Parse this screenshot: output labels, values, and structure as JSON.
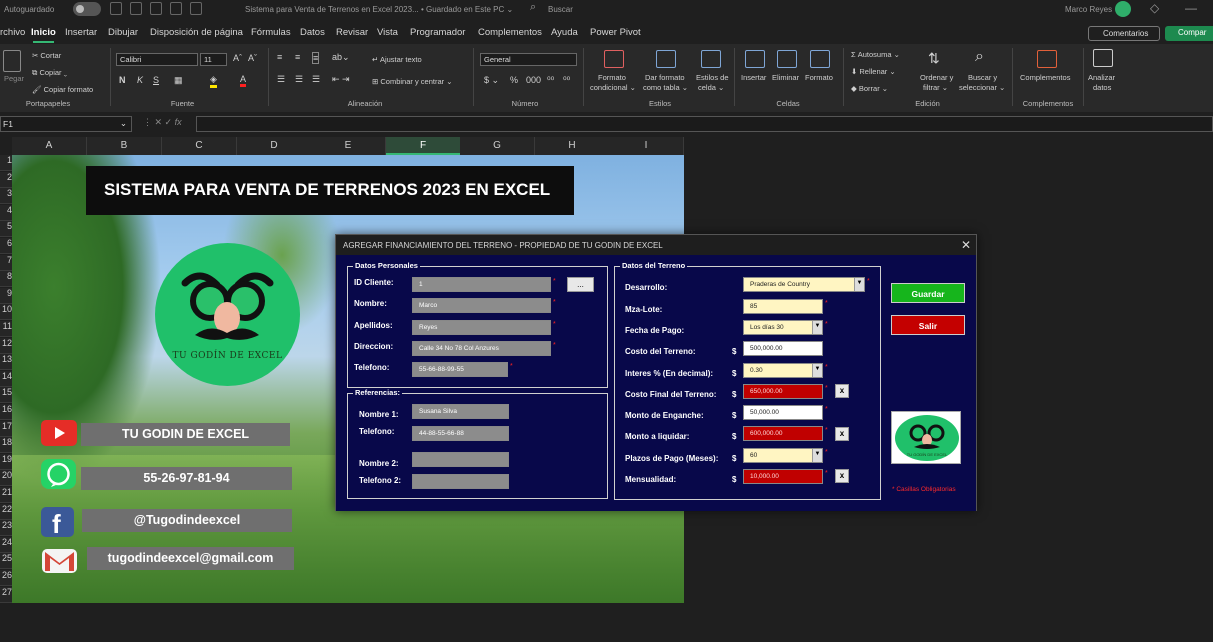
{
  "titlebar": {
    "autosave": "Autoguardado",
    "document": "Sistema para Venta de Terrenos en Excel 2023... • Guardado en Este PC ⌄",
    "search_placeholder": "Buscar",
    "user": "Marco Reyes"
  },
  "menu": {
    "tabs": [
      "rchivo",
      "Inicio",
      "Insertar",
      "Dibujar",
      "Disposición de página",
      "Fórmulas",
      "Datos",
      "Revisar",
      "Vista",
      "Programador",
      "Complementos",
      "Ayuda",
      "Power Pivot"
    ],
    "active": "Inicio",
    "comments": "Comentarios",
    "share": "Compar"
  },
  "ribbon": {
    "paste": "Pegar",
    "cut": "Cortar",
    "copy": "Copiar",
    "format_painter": "Copiar formato",
    "clipboard": "Portapapeles",
    "font_name": "Calibri",
    "font_size": "11",
    "bold": "N",
    "italic": "K",
    "underline": "S",
    "font_group": "Fuente",
    "wrap_text": "Ajustar texto",
    "merge": "Combinar y centrar",
    "align_group": "Alineación",
    "number_format": "General",
    "number_group": "Número",
    "cond_format_1": "Formato",
    "cond_format_2": "condicional ⌄",
    "as_table_1": "Dar formato",
    "as_table_2": "como tabla ⌄",
    "cell_styles_1": "Estilos de",
    "cell_styles_2": "celda ⌄",
    "styles_group": "Estilos",
    "insert": "Insertar",
    "delete": "Eliminar",
    "format": "Formato",
    "cells_group": "Celdas",
    "autosum": "Autosuma ⌄",
    "fill": "Rellenar ⌄",
    "clear": "Borrar ⌄",
    "sort_1": "Ordenar y",
    "sort_2": "filtrar ⌄",
    "find_1": "Buscar y",
    "find_2": "seleccionar ⌄",
    "editing_group": "Edición",
    "addins": "Complementos",
    "addins_group": "Complementos",
    "analyze_1": "Analizar",
    "analyze_2": "datos"
  },
  "formula_bar": {
    "name_box": "F1",
    "fx": "fx"
  },
  "columns": [
    "A",
    "B",
    "C",
    "D",
    "E",
    "F",
    "G",
    "H",
    "I"
  ],
  "selected_column": "F",
  "rows": [
    "1",
    "2",
    "3",
    "4",
    "5",
    "6",
    "7",
    "8",
    "9",
    "10",
    "11",
    "12",
    "13",
    "14",
    "15",
    "16",
    "17",
    "18",
    "19",
    "20",
    "21",
    "22",
    "23",
    "24",
    "25",
    "26",
    "27"
  ],
  "sheet": {
    "banner": "SISTEMA PARA VENTA DE TERRENOS 2023 EN EXCEL",
    "logo_text": "TU GODÍN DE EXCEL",
    "youtube": "TU GODIN DE EXCEL",
    "whatsapp": "55-26-97-81-94",
    "facebook": "@Tugodindeexcel",
    "email": "tugodindeexcel@gmail.com",
    "colors": {
      "youtube": "#e52d27",
      "whatsapp": "#25d366",
      "facebook": "#3b5998",
      "gmail": "#d44638"
    }
  },
  "dialog": {
    "title": "AGREGAR FINANCIAMIENTO DEL TERRENO - PROPIEDAD DE TU GODIN DE EXCEL",
    "personal": {
      "frame": "Datos Personales",
      "id_label": "ID Cliente:",
      "id_value": "1",
      "browse": "...",
      "name_label": "Nombre:",
      "name_value": "Marco",
      "last_label": "Apellidos:",
      "last_value": "Reyes",
      "address_label": "Direccion:",
      "address_value": "Calle 34 No 78 Col Anzures",
      "phone_label": "Telefono:",
      "phone_value": "55-66-88-99-55"
    },
    "refs": {
      "frame": "Referencias:",
      "name1_label": "Nombre 1:",
      "name1_value": "Susana Silva",
      "phone1_label": "Telefono:",
      "phone1_value": "44-88-55-66-88",
      "name2_label": "Nombre 2:",
      "name2_value": "",
      "phone2_label": "Telefono 2:",
      "phone2_value": ""
    },
    "land": {
      "frame": "Datos del Terreno",
      "dev_label": "Desarrollo:",
      "dev_value": "Praderas de Country",
      "lot_label": "Mza-Lote:",
      "lot_value": "85",
      "pay_date_label": "Fecha de Pago:",
      "pay_date_value": "Los días 30",
      "cost_label": "Costo del Terreno:",
      "cost_value": "500,000.00",
      "interest_label": "Interes % (En decimal):",
      "interest_value": "0.30",
      "final_label": "Costo Final del Terreno:",
      "final_value": "650,000.00",
      "down_label": "Monto de Enganche:",
      "down_value": "50,000.00",
      "liquidate_label": "Monto a liquidar:",
      "liquidate_value": "600,000.00",
      "terms_label": "Plazos de Pago (Meses):",
      "terms_value": "60",
      "monthly_label": "Mensualidad:",
      "monthly_value": "10,000.00",
      "currency": "$",
      "calc": "x"
    },
    "save": "Guardar",
    "exit": "Salir",
    "required_note": "* Casillas Obligatorias",
    "mini_logo": "TU GODÍN DE EXCEL",
    "colors": {
      "body": "#08084a",
      "save": "#16b51c",
      "exit": "#c40000"
    }
  }
}
